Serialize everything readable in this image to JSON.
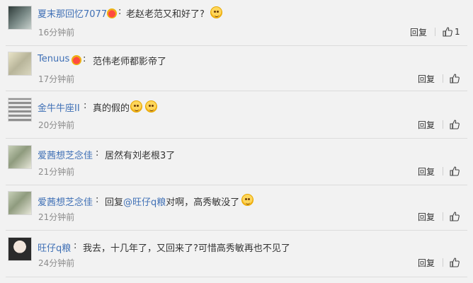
{
  "comments": [
    {
      "name": "夏末那回忆7077",
      "text": "老赵老范又和好了?",
      "time": "16分钟前",
      "reply": "回复",
      "likes": "1",
      "emoji": "emoji-icon"
    },
    {
      "name": "Tenuus",
      "text": "范伟老师都影帝了",
      "time": "17分钟前",
      "reply": "回复",
      "likes": ""
    },
    {
      "name": "金牛牛座II",
      "text": "真的假的",
      "time": "20分钟前",
      "reply": "回复",
      "likes": ""
    },
    {
      "name": "爱茜想芝念佳",
      "text": "居然有刘老根3了",
      "time": "21分钟前",
      "reply": "回复",
      "likes": ""
    },
    {
      "name": "爱茜想芝念佳",
      "text_prefix": "回复",
      "mention": "@旺仔q粮",
      "text": "对啊，高秀敏没了",
      "time": "21分钟前",
      "reply": "回复",
      "likes": ""
    },
    {
      "name": "旺仔q粮",
      "text": "我去，十几年了，又回来了?可惜高秀敏再也不见了",
      "time": "24分钟前",
      "reply": "回复",
      "likes": ""
    }
  ]
}
